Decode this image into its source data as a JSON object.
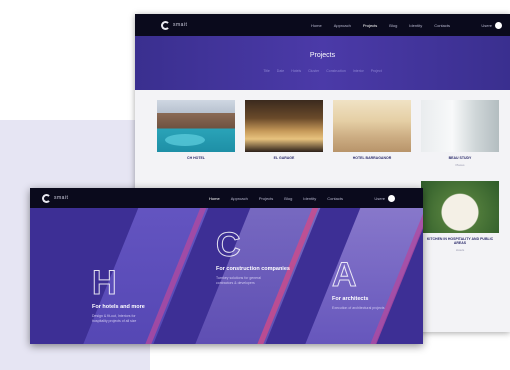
{
  "back_window": {
    "logo_text": "smait",
    "nav": [
      "Home",
      "Approach",
      "Projects",
      "Blog",
      "Identity",
      "Contacts"
    ],
    "active_nav": "Projects",
    "user_label": "Usere",
    "hero_title": "Projects",
    "filters": [
      "Title",
      "Date",
      "Hotels",
      "Cluster",
      "Construction",
      "Interior",
      "Project"
    ],
    "projects": [
      {
        "caption": "CH HOTEL",
        "sub": ""
      },
      {
        "caption": "EL GARAGE",
        "sub": ""
      },
      {
        "caption": "HOTEL BARRAGANOR",
        "sub": ""
      },
      {
        "caption": "BEAU STUDY",
        "sub": "Places"
      },
      {
        "caption": "",
        "sub": ""
      },
      {
        "caption": "",
        "sub": ""
      },
      {
        "caption": "",
        "sub": ""
      },
      {
        "caption": "KITCHEN IN HOSPITALITY AND PUBLIC AREAS",
        "sub": "Hotels"
      }
    ]
  },
  "front_window": {
    "logo_text": "smait",
    "nav": [
      "Home",
      "Approach",
      "Projects",
      "Blog",
      "Identity",
      "Contacts"
    ],
    "active_nav": "Home",
    "user_label": "Usere",
    "columns": [
      {
        "letter": "H",
        "title": "For hotels and more",
        "desc": "Design & fit-out, Interiors for hospitality projects of all size"
      },
      {
        "letter": "C",
        "title": "For construction companies",
        "desc": "Turnkey solutions for general contractors & developers"
      },
      {
        "letter": "A",
        "title": "For architects",
        "desc": "Execution of architectural projects"
      }
    ]
  }
}
